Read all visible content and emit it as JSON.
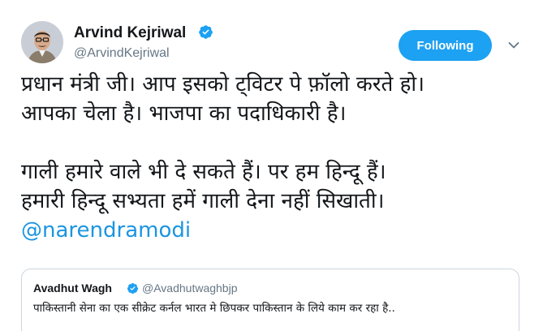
{
  "author": {
    "name": "Arvind Kejriwal",
    "handle": "@ArvindKejriwal",
    "verified": true
  },
  "follow_button": {
    "label": "Following"
  },
  "tweet": {
    "lines": [
      "प्रधान मंत्री जी। आप इसको ट्विटर पे फ़ॉलो करते हो।",
      "आपका चेला है। भाजपा का पदाधिकारी है।",
      "गाली हमारे वाले भी दे सकते हैं। पर हम हिन्दू हैं।",
      "हमारी हिन्दू सभ्यता हमें गाली देना नहीं सिखाती।"
    ],
    "mention": "@narendramodi"
  },
  "quoted_tweet": {
    "name": "Avadhut Wagh",
    "handle": "@Avadhutwaghbjp",
    "verified": true,
    "text": "पाकिस्तानी सेना का एक सीक्रेट कर्नल भारत मे छिपकर पाकिस्तान के लिये काम कर रहा है.."
  },
  "colors": {
    "accent": "#1da1f2",
    "link": "#1b95e0",
    "secondary_text": "#657786",
    "border": "#ccd6dd"
  }
}
